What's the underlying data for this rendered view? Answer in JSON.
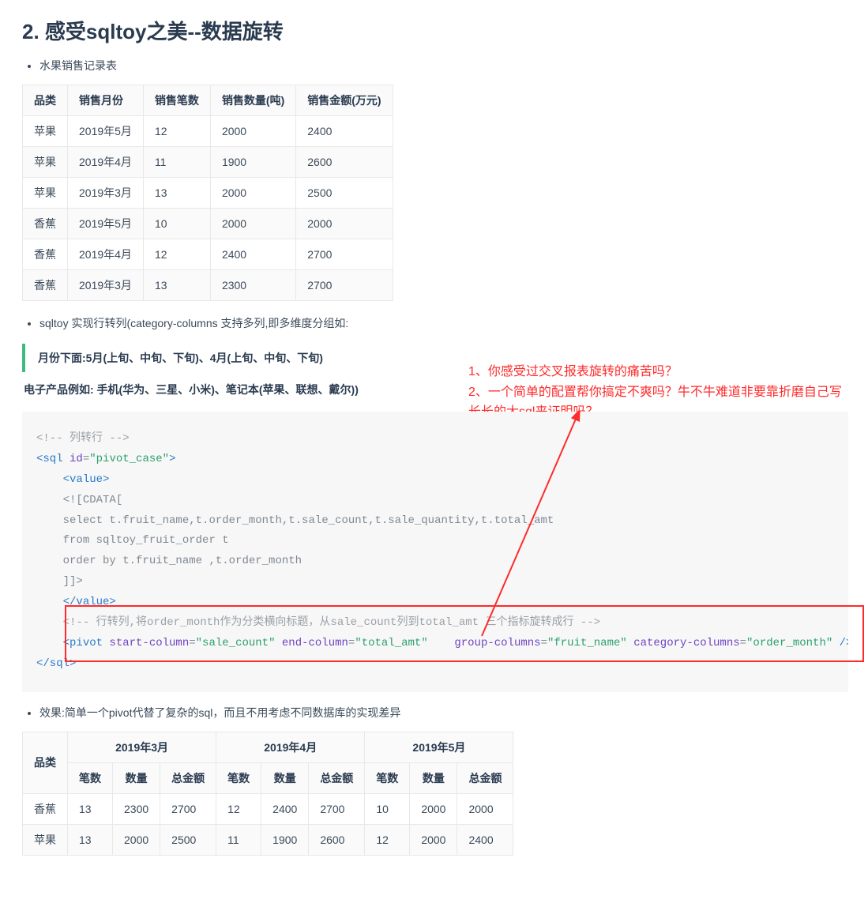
{
  "heading": "2. 感受sqltoy之美--数据旋转",
  "bullets1": [
    "水果销售记录表"
  ],
  "table1": {
    "headers": [
      "品类",
      "销售月份",
      "销售笔数",
      "销售数量(吨)",
      "销售金额(万元)"
    ],
    "rows": [
      [
        "苹果",
        "2019年5月",
        "12",
        "2000",
        "2400"
      ],
      [
        "苹果",
        "2019年4月",
        "11",
        "1900",
        "2600"
      ],
      [
        "苹果",
        "2019年3月",
        "13",
        "2000",
        "2500"
      ],
      [
        "香蕉",
        "2019年5月",
        "10",
        "2000",
        "2000"
      ],
      [
        "香蕉",
        "2019年4月",
        "12",
        "2400",
        "2700"
      ],
      [
        "香蕉",
        "2019年3月",
        "13",
        "2300",
        "2700"
      ]
    ]
  },
  "bullets2": [
    "sqltoy 实现行转列(category-columns 支持多列,即多维度分组如:"
  ],
  "blockquote": "月份下面:5月(上旬、中旬、下旬)、4月(上旬、中旬、下旬)",
  "subline": "电子产品例如: 手机(华为、三星、小米)、笔记本(苹果、联想、戴尔))",
  "annot": {
    "line1": "1、你感受过交叉报表旋转的痛苦吗？",
    "line2": "2、一个简单的配置帮你搞定不爽吗？牛不牛难道非要靠折磨自己写长长的大sql来证明吗？"
  },
  "code": {
    "c1": "<!-- 列转行 -->",
    "sql_open_a": "<sql ",
    "sql_open_attr": "id",
    "sql_open_eq": "=",
    "sql_open_val": "\"pivot_case\"",
    "sql_open_b": ">",
    "value_open": "<value>",
    "cdata_open": "<![CDATA[",
    "line_select": "select t.fruit_name,t.order_month,t.sale_count,t.sale_quantity,t.total_amt",
    "line_from": "from sqltoy_fruit_order t",
    "line_order": "order by t.fruit_name ,t.order_month",
    "cdata_close": "]]>",
    "value_close": "</value>",
    "cmt2": "<!-- 行转列,将order_month作为分类横向标题，从sale_count列到total_amt 三个指标旋转成行 -->",
    "pivot_open": "<pivot ",
    "pattr1": "start-column",
    "peq": "=",
    "pval1": "\"sale_count\"",
    "pattr2": "end-column",
    "pval2": "\"total_amt\"",
    "gap": "    ",
    "pattr3": "group-columns",
    "pval3": "\"fruit_name\"",
    "pattr4": "category-columns",
    "pval4": "\"order_month\"",
    "pivot_close_tail": " />",
    "sql_close": "</sql>"
  },
  "bullets3": [
    "效果:简单一个pivot代替了复杂的sql，而且不用考虑不同数据库的实现差异"
  ],
  "table2": {
    "topheader_first": "品类",
    "months": [
      "2019年3月",
      "2019年4月",
      "2019年5月"
    ],
    "sub": [
      "笔数",
      "数量",
      "总金额"
    ],
    "rows": [
      [
        "香蕉",
        "13",
        "2300",
        "2700",
        "12",
        "2400",
        "2700",
        "10",
        "2000",
        "2000"
      ],
      [
        "苹果",
        "13",
        "2000",
        "2500",
        "11",
        "1900",
        "2600",
        "12",
        "2000",
        "2400"
      ]
    ]
  }
}
